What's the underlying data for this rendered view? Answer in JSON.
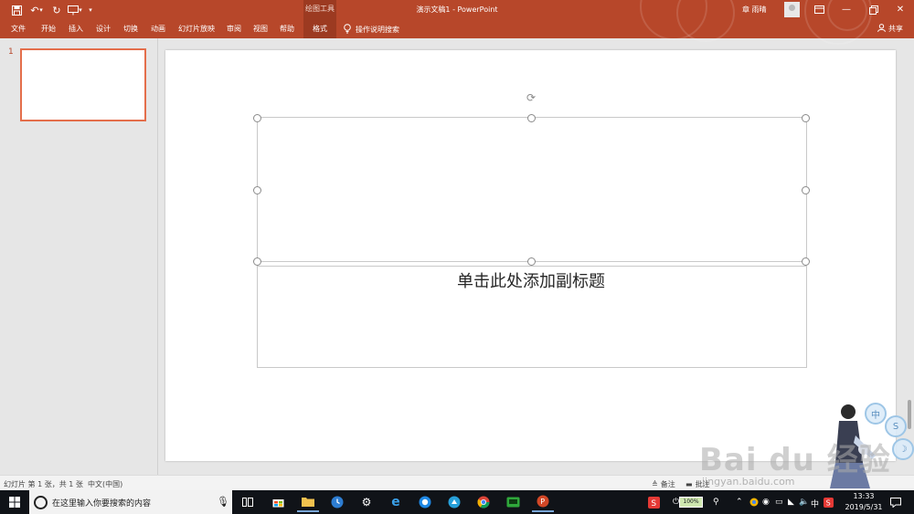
{
  "app": {
    "document_title": "演示文稿1  -  PowerPoint",
    "contextual_group": "绘图工具",
    "user_name": "章 雨晴",
    "share_label": "共享",
    "tell_me": "操作说明搜索"
  },
  "tabs": [
    "文件",
    "开始",
    "插入",
    "设计",
    "切换",
    "动画",
    "幻灯片放映",
    "审阅",
    "视图",
    "帮助",
    "格式"
  ],
  "thumbnails": [
    {
      "number": "1"
    }
  ],
  "slide": {
    "subtitle_placeholder": "单击此处添加副标题"
  },
  "status": {
    "slide_info": "幻灯片 第 1 张，共 1 张",
    "language": "中文(中国)",
    "notes": "备注",
    "comments": "批注"
  },
  "watermark": {
    "text": "Bai du 经验",
    "url": "jingyan.baidu.com",
    "bubbles": [
      "中",
      "S"
    ]
  },
  "taskbar": {
    "search_placeholder": "在这里输入你要搜索的内容",
    "battery": "100%",
    "tray_ime": "中",
    "time": "13:33",
    "date": "2019/5/31"
  },
  "colors": {
    "ribbon": "#b7472a",
    "thumb_border": "#e46e4b",
    "taskbar": "#101318"
  },
  "icons": [
    "save-icon",
    "undo-icon",
    "redo-icon",
    "slideshow-icon",
    "customize-qat-icon",
    "lightbulb-icon",
    "share-person-icon",
    "rotate-handle-icon",
    "windows-logo-icon",
    "search-icon",
    "mic-icon",
    "task-view-icon",
    "store-icon",
    "file-explorer-icon",
    "clock-app-icon",
    "settings-icon",
    "edge-icon",
    "browser-icon",
    "app-icon",
    "chrome-icon",
    "game-icon",
    "powerpoint-icon",
    "sogou-icon",
    "battery-icon",
    "network-icon",
    "volume-icon",
    "notification-icon"
  ]
}
